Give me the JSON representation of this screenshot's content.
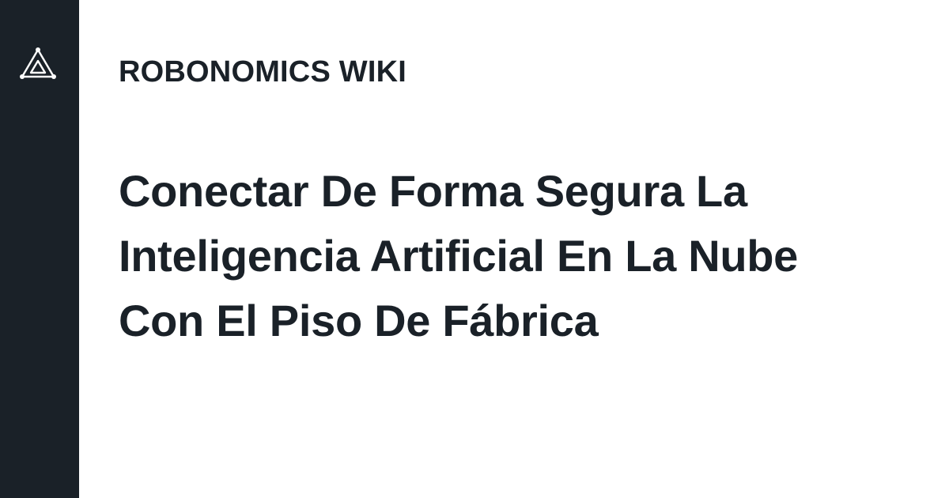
{
  "brand": {
    "logo_icon": "robonomics-triangle-logo-icon",
    "sidebar_color": "#1a2128",
    "text_color": "#1a2128"
  },
  "header": {
    "site_name": "ROBONOMICS WIKI"
  },
  "main": {
    "title": "Conectar De Forma Segura La Inteligencia Artificial En La Nube Con El Piso De Fábrica"
  }
}
